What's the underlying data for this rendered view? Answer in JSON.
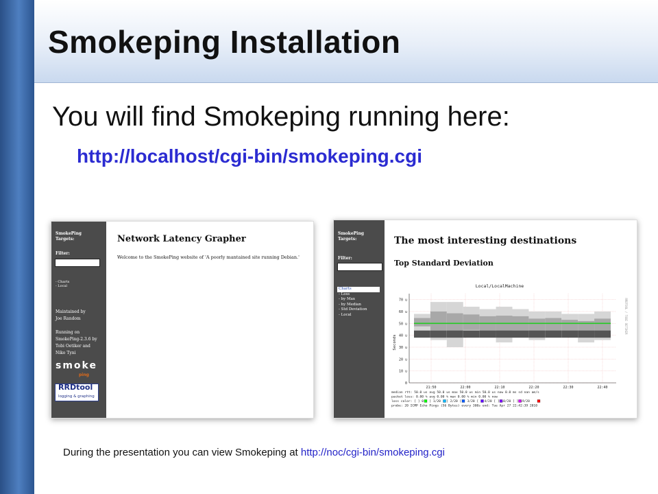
{
  "slide": {
    "title": "Smokeping Installation",
    "subtitle": "You will find Smokeping running here:",
    "url": "http://localhost/cgi-bin/smokeping.cgi",
    "footer_text": "During the presentation you can view Smokeping at ",
    "footer_link": "http://noc/cgi-bin/smokeping.cgi",
    "colors": {
      "accent": "#2b2bd1",
      "bar": "#3b6aa8",
      "title_bg": "#c9d9ef"
    }
  },
  "screenshot_left": {
    "sidebar": {
      "heading_line1": "SmokePing",
      "heading_line2": "Targets:",
      "filter_label": "Filter:",
      "items": [
        "- Charts",
        "- Local"
      ],
      "maintained_line1": "Maintained by",
      "maintained_line2": "Joe Random",
      "running_line1": "Running on",
      "running_line2": "SmokePing-2.3.6 by",
      "running_line3": "Tobi Oetiker and",
      "running_line4": "Niko Tyni",
      "logo_smoke": "smoke",
      "logo_ping": "ping",
      "logo_rrd": "RRDtool",
      "logo_rrd_sub": "logging & graphing"
    },
    "heading": "Network Latency Grapher",
    "welcome": "Welcome to the SmokePing website of 'A poorly mantained site running Debian.'"
  },
  "screenshot_right": {
    "sidebar": {
      "heading_line1": "SmokePing",
      "heading_line2": "Targets:",
      "filter_label": "Filter:",
      "items": [
        "Charts",
        "- Loss",
        "- by Max",
        "- by Median",
        "- Std Deviation",
        "- Local"
      ]
    },
    "heading": "The most interesting destinations",
    "subheading": "Top Standard Deviation",
    "chart_data": {
      "type": "area",
      "title": "Local/LocalMachine",
      "ylabel": "Seconds",
      "side_label": "RRDTOOL / TOBI OETIKER",
      "y_ticks": [
        "70 u",
        "60 u",
        "50 u",
        "40 u",
        "30 u",
        "20 u",
        "10 u",
        "0"
      ],
      "ylim": [
        0,
        75
      ],
      "x_ticks": [
        "21:50",
        "22:00",
        "22:10",
        "22:20",
        "22:30",
        "22:40"
      ],
      "median_rtt_us": 50,
      "smoke_bands_us": [
        {
          "low": 44,
          "high": 58
        },
        {
          "low": 36,
          "high": 68
        },
        {
          "low": 30,
          "high": 68
        },
        {
          "low": 38,
          "high": 64
        },
        {
          "low": 38,
          "high": 62
        },
        {
          "low": 34,
          "high": 64
        },
        {
          "low": 38,
          "high": 62
        },
        {
          "low": 36,
          "high": 60
        },
        {
          "low": 38,
          "high": 60
        },
        {
          "low": 38,
          "high": 58
        },
        {
          "low": 34,
          "high": 58
        },
        {
          "low": 36,
          "high": 60
        }
      ],
      "legend_lines": [
        "median rtt:   50.0 us avg   50.0 us max   50.0 us min   50.0 us now   0.0 ms sd  nan   am/s",
        "packet loss:  0.00 % avg   0.00 % max   0.00 % min   0.00 % now",
        "loss color:   [ ] 0   [ ] 1/20   [ ] 2/20   [ ] 3/20   [ ] 4/20   [ ] 10/20   [ ] 19/20",
        "probe:        20 ICMP Echo Pings (56 Bytes) every 300s            end: Tue Apr 27 22:42:39 2010"
      ]
    }
  }
}
